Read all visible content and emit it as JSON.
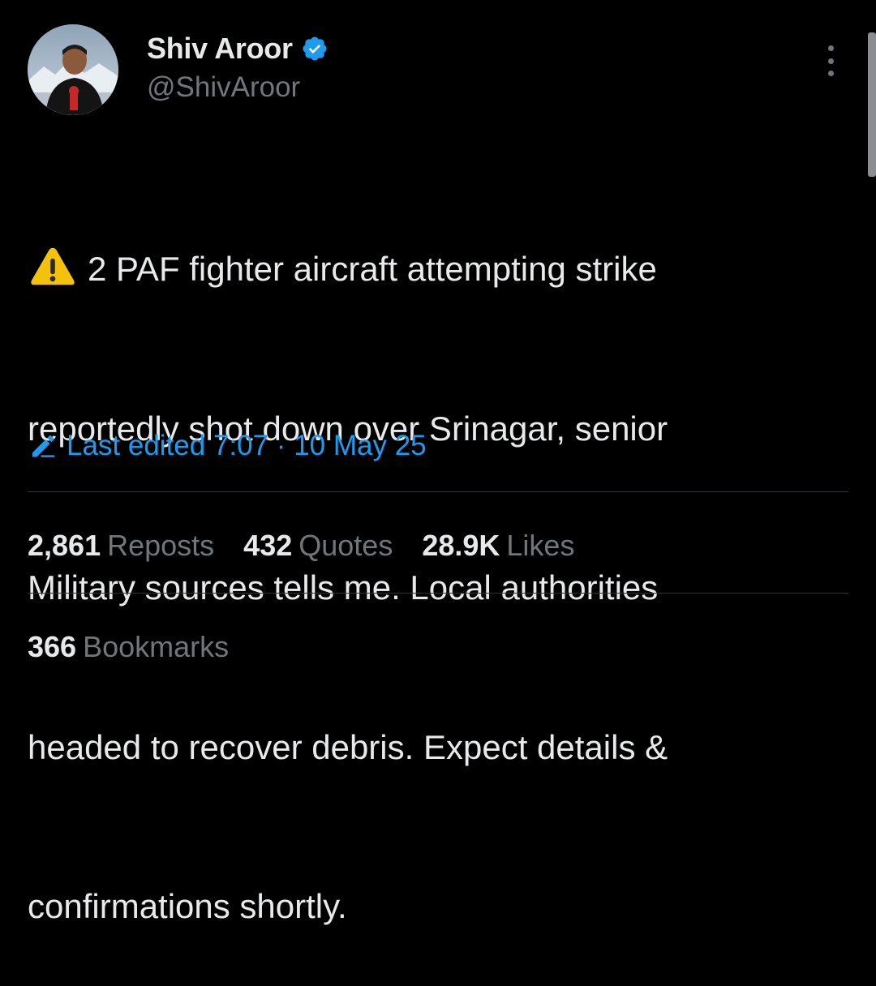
{
  "author": {
    "display_name": "Shiv Aroor",
    "handle": "@ShivAroor",
    "verified_color": "#1d9bf0"
  },
  "tweet": {
    "warning_icon": "warning-emoji",
    "lines": [
      "2 PAF fighter aircraft attempting strike",
      "reportedly shot down over Srinagar, senior",
      "Military sources tells me. Local authorities",
      "headed to recover debris. Expect details &",
      "confirmations shortly."
    ],
    "edited_label": "Last edited 7:07 · 10 May 25"
  },
  "stats": {
    "reposts_count": "2,861",
    "reposts_label": "Reposts",
    "quotes_count": "432",
    "quotes_label": "Quotes",
    "likes_count": "28.9K",
    "likes_label": "Likes",
    "bookmarks_count": "366",
    "bookmarks_label": "Bookmarks"
  },
  "colors": {
    "background": "#000000",
    "primary_text": "#e7e9ea",
    "secondary_text": "#71767b",
    "accent": "#1d9bf0",
    "divider": "#2f3336"
  }
}
